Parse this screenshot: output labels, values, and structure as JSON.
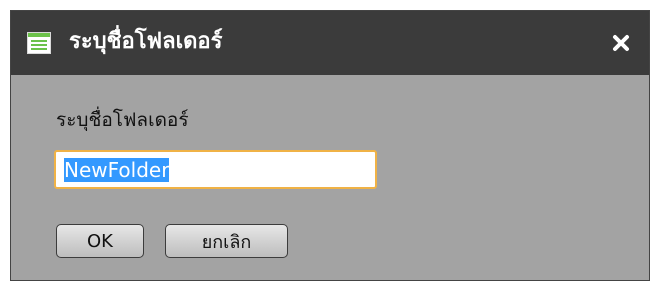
{
  "dialog": {
    "title": "ระบุชื่อโฟลเดอร์",
    "title_icon": "list-window-icon",
    "close_icon": "close-icon",
    "close_symbol": "×",
    "field_label": "ระบุชื่อโฟลเดอร์",
    "input_value": "NewFolder",
    "input_selected": true,
    "ok_label": "OK",
    "cancel_label": "ยกเลิก"
  },
  "colors": {
    "titlebar": "#3b3b3b",
    "body": "#a3a3a3",
    "input_focus_border": "#f0b246",
    "selection": "#3399ff",
    "title_icon_accent": "#6cc24a"
  }
}
